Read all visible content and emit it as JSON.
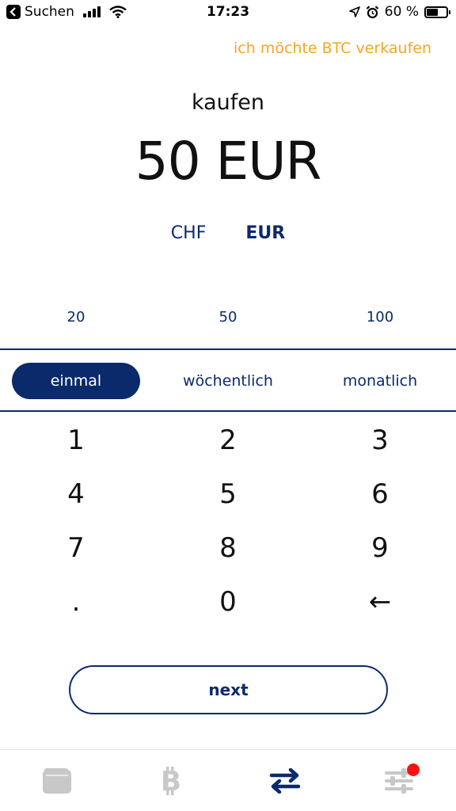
{
  "statusbar": {
    "back_app": "Suchen",
    "time": "17:23",
    "battery": "60 %",
    "battery_level": 0.6
  },
  "header": {
    "sell_link": "ich möchte BTC verkaufen"
  },
  "main": {
    "mode_label": "kaufen",
    "amount": "50 EUR",
    "currencies": [
      "CHF",
      "EUR"
    ],
    "selected_currency": "EUR",
    "quick_amounts": [
      "20",
      "50",
      "100"
    ],
    "frequencies": [
      "einmal",
      "wöchentlich",
      "monatlich"
    ],
    "selected_frequency": "einmal"
  },
  "keypad": {
    "keys": [
      "1",
      "2",
      "3",
      "4",
      "5",
      "6",
      "7",
      "8",
      "9",
      ".",
      "0",
      "←"
    ]
  },
  "actions": {
    "next_label": "next"
  },
  "tabbar": {
    "tabs": [
      "wallet-icon",
      "bitcoin-icon",
      "exchange-icon",
      "settings-icon"
    ],
    "active_tab": "exchange-icon",
    "settings_has_badge": true
  },
  "colors": {
    "primary": "#0b2a6b",
    "accent": "#f5a623",
    "badge": "#ff1010",
    "inactive_icon": "#c8c8c8"
  }
}
